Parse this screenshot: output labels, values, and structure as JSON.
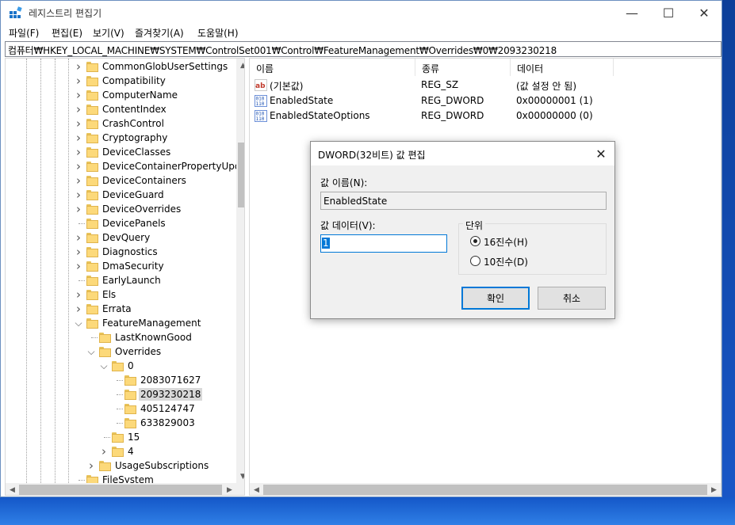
{
  "window": {
    "title": "레지스트리 편집기",
    "controls": {
      "minimize": "—",
      "maximize": "☐",
      "close": "✕"
    }
  },
  "menu": [
    "파일(F)",
    "편집(E)",
    "보기(V)",
    "즐겨찾기(A)",
    "도움말(H)"
  ],
  "address": "컴퓨터₩HKEY_LOCAL_MACHINE₩SYSTEM₩ControlSet001₩Control₩FeatureManagement₩Overrides₩0₩2093230218",
  "tree": {
    "level1": [
      "CommonGlobUserSettings",
      "Compatibility",
      "ComputerName",
      "ContentIndex",
      "CrashControl",
      "Cryptography",
      "DeviceClasses",
      "DeviceContainerPropertyUpdat",
      "DeviceContainers",
      "DeviceGuard",
      "DeviceOverrides",
      "DevicePanels",
      "DevQuery",
      "Diagnostics",
      "DmaSecurity",
      "EarlyLaunch",
      "Els",
      "Errata",
      "FeatureManagement"
    ],
    "fm_children": [
      "LastKnownGood",
      "Overrides",
      "UsageSubscriptions"
    ],
    "override_children": [
      "0",
      "15",
      "4"
    ],
    "zero_children": [
      "2083071627",
      "2093230218",
      "405124747",
      "633829003"
    ],
    "selected": "2093230218",
    "last": "FileSystem"
  },
  "list": {
    "headers": [
      "이름",
      "종류",
      "데이터"
    ],
    "rows": [
      {
        "name": "(기본값)",
        "type": "REG_SZ",
        "data": "(값 설정 안 됨)",
        "icon": "string-value-icon"
      },
      {
        "name": "EnabledState",
        "type": "REG_DWORD",
        "data": "0x00000001 (1)",
        "icon": "binary-value-icon"
      },
      {
        "name": "EnabledStateOptions",
        "type": "REG_DWORD",
        "data": "0x00000000 (0)",
        "icon": "binary-value-icon"
      }
    ]
  },
  "dialog": {
    "title": "DWORD(32비트) 값 편집",
    "name_label": "값 이름(N):",
    "name_value": "EnabledState",
    "data_label": "값 데이터(V):",
    "data_value": "1",
    "base_label": "단위",
    "base_options": [
      "16진수(H)",
      "10진수(D)"
    ],
    "base_selected": "16진수(H)",
    "ok_label": "확인",
    "cancel_label": "취소",
    "close": "✕"
  },
  "colors": {
    "accent": "#0078d7",
    "folder": "#fcd97a",
    "desktop": "#1a63d8"
  }
}
